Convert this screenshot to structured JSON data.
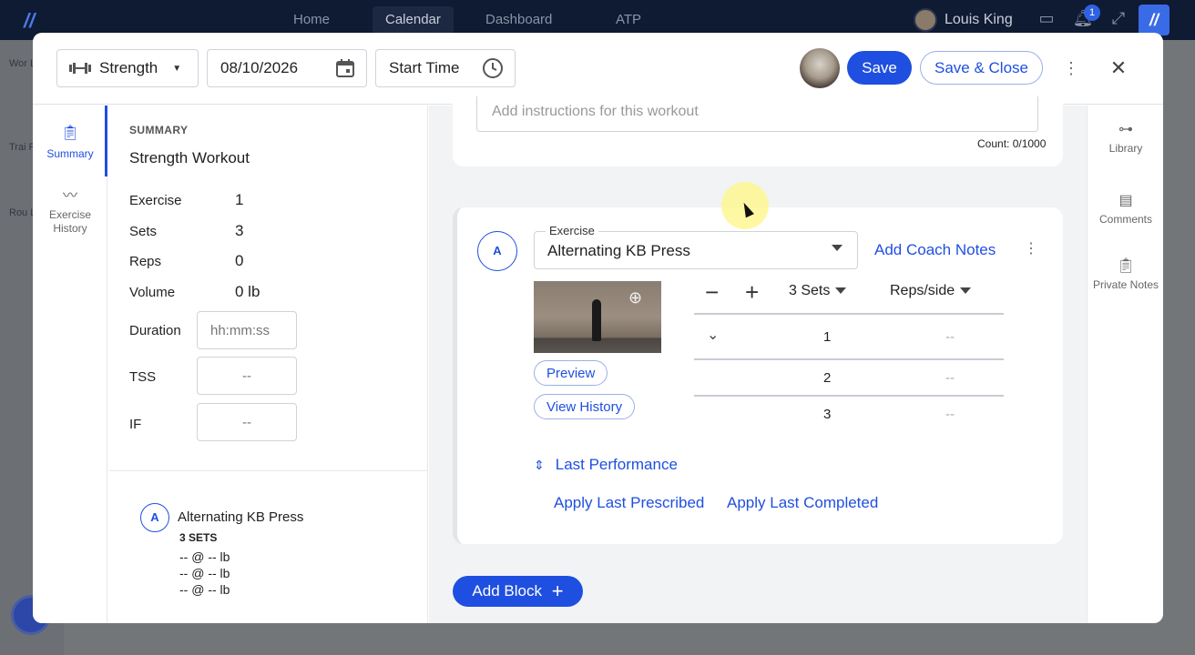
{
  "topnav": {
    "items": [
      "Home",
      "Calendar",
      "Dashboard",
      "ATP"
    ],
    "active": "Calendar",
    "user_name": "Louis King",
    "notification_count": "1"
  },
  "bg_sidebar": {
    "items": [
      {
        "label": "Wor Libr"
      },
      {
        "label": "Trai Pla"
      },
      {
        "label": "Rou Libr"
      }
    ]
  },
  "header": {
    "workout_type": "Strength",
    "date": "08/10/2026",
    "start_time_label": "Start Time",
    "save_label": "Save",
    "save_close_label": "Save & Close"
  },
  "left_tabs": {
    "summary": "Summary",
    "exercise_history": "Exercise History"
  },
  "summary": {
    "heading": "SUMMARY",
    "title": "Strength Workout",
    "exercise_label": "Exercise",
    "exercise_value": "1",
    "sets_label": "Sets",
    "sets_value": "3",
    "reps_label": "Reps",
    "reps_value": "0",
    "volume_label": "Volume",
    "volume_value": "0 lb",
    "duration_label": "Duration",
    "duration_placeholder": "hh:mm:ss",
    "tss_label": "TSS",
    "tss_placeholder": "--",
    "if_label": "IF",
    "if_placeholder": "--",
    "block": {
      "letter": "A",
      "name": "Alternating KB Press",
      "sets_text": "3 SETS",
      "rows": [
        "-- @ -- lb",
        "-- @ -- lb",
        "-- @ -- lb"
      ]
    }
  },
  "instructions": {
    "placeholder": "Add instructions for this workout",
    "count": "Count: 0/1000"
  },
  "exercise_card": {
    "letter": "A",
    "field_label": "Exercise",
    "exercise_name": "Alternating KB Press",
    "add_coach_notes": "Add Coach Notes",
    "preview_label": "Preview",
    "view_history_label": "View History",
    "sets_dropdown": "3 Sets",
    "reps_dropdown": "Reps/side",
    "rows": [
      {
        "num": "1",
        "reps": "--"
      },
      {
        "num": "2",
        "reps": "--"
      },
      {
        "num": "3",
        "reps": "--"
      }
    ],
    "last_performance": "Last Performance",
    "apply_last_prescribed": "Apply Last Prescribed",
    "apply_last_completed": "Apply Last Completed"
  },
  "add_block_label": "Add Block",
  "right_rail": {
    "library": "Library",
    "comments": "Comments",
    "private_notes": "Private Notes"
  },
  "colors": {
    "accent": "#1f4fe0",
    "nav_bg": "#0f1a33"
  }
}
